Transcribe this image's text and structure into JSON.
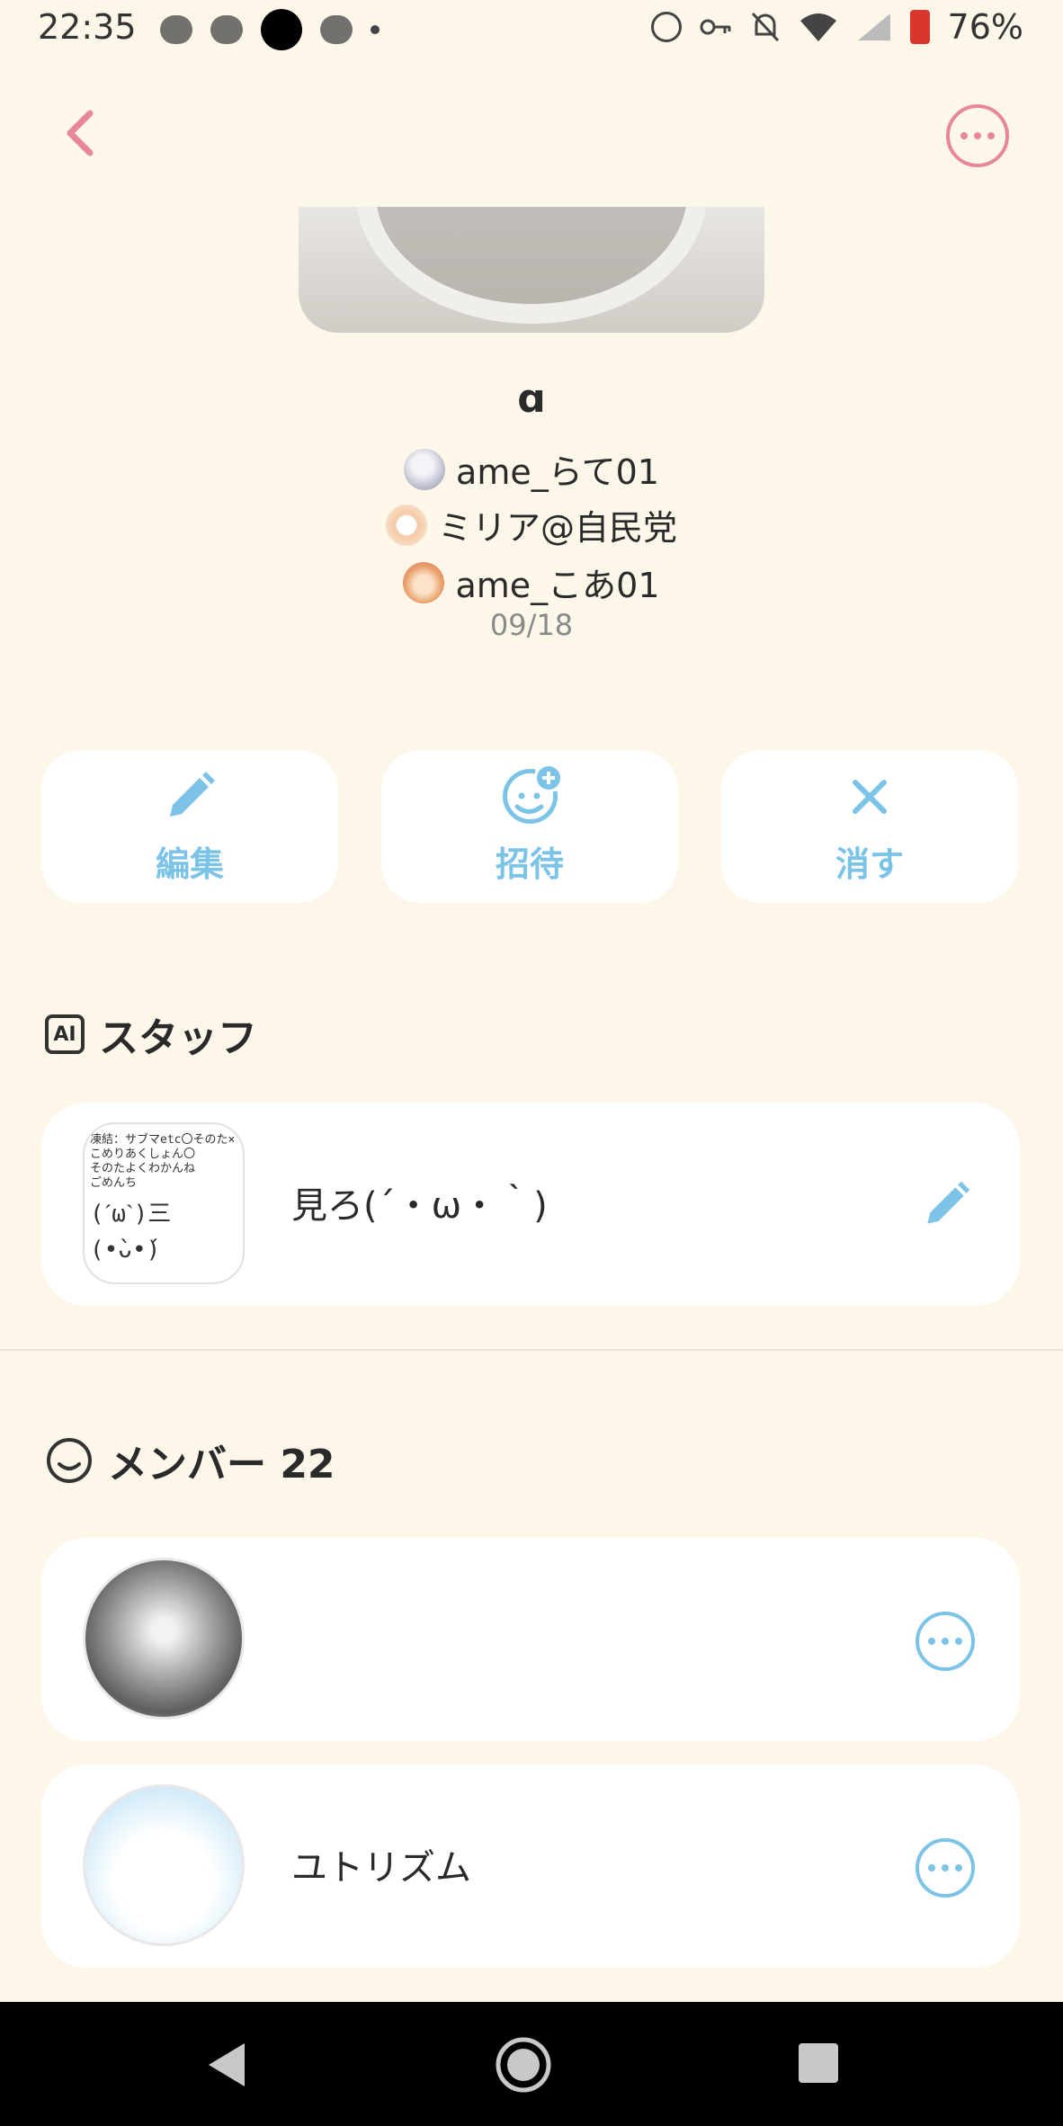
{
  "status_bar": {
    "time": "22:35",
    "battery_percent": "76%",
    "icons": [
      "weather-icon",
      "cloud-icon",
      "camera-hole",
      "cloud-icon",
      "dot-icon",
      "alarm-icon",
      "key-icon",
      "bell-off-icon",
      "wifi-icon",
      "signal-icon",
      "battery-icon"
    ]
  },
  "header": {
    "back_icon": "chevron-left-icon",
    "more_icon": "more-icon"
  },
  "group": {
    "title": "ɑ",
    "owners": [
      {
        "name": "ame_らて01"
      },
      {
        "name": "ミリア@自民党"
      },
      {
        "name": "ame_こあ01"
      }
    ],
    "date": "09/18"
  },
  "actions": [
    {
      "label": "編集",
      "icon": "pencil-icon"
    },
    {
      "label": "招待",
      "icon": "invite-icon"
    },
    {
      "label": "消す",
      "icon": "close-icon"
    }
  ],
  "staff": {
    "heading": "スタッフ",
    "ai_badge": "AI",
    "item": {
      "title": "見ろ(´・ω・｀)",
      "thumb_lines": [
        "凍結：サブマetc〇そのた×",
        "こめりあくしょん〇",
        "そのたよくわかんね",
        "ごめんち",
        "(ˊωˋ)三(•̀ᴗ•́)"
      ]
    }
  },
  "members": {
    "heading": "メンバー 22",
    "items": [
      {
        "name": "￼"
      },
      {
        "name": "ユトリズム"
      }
    ]
  },
  "colors": {
    "background": "#fdf7e9",
    "accent_pink": "#e8879a",
    "accent_blue": "#7cc3e8",
    "card": "#ffffff"
  }
}
